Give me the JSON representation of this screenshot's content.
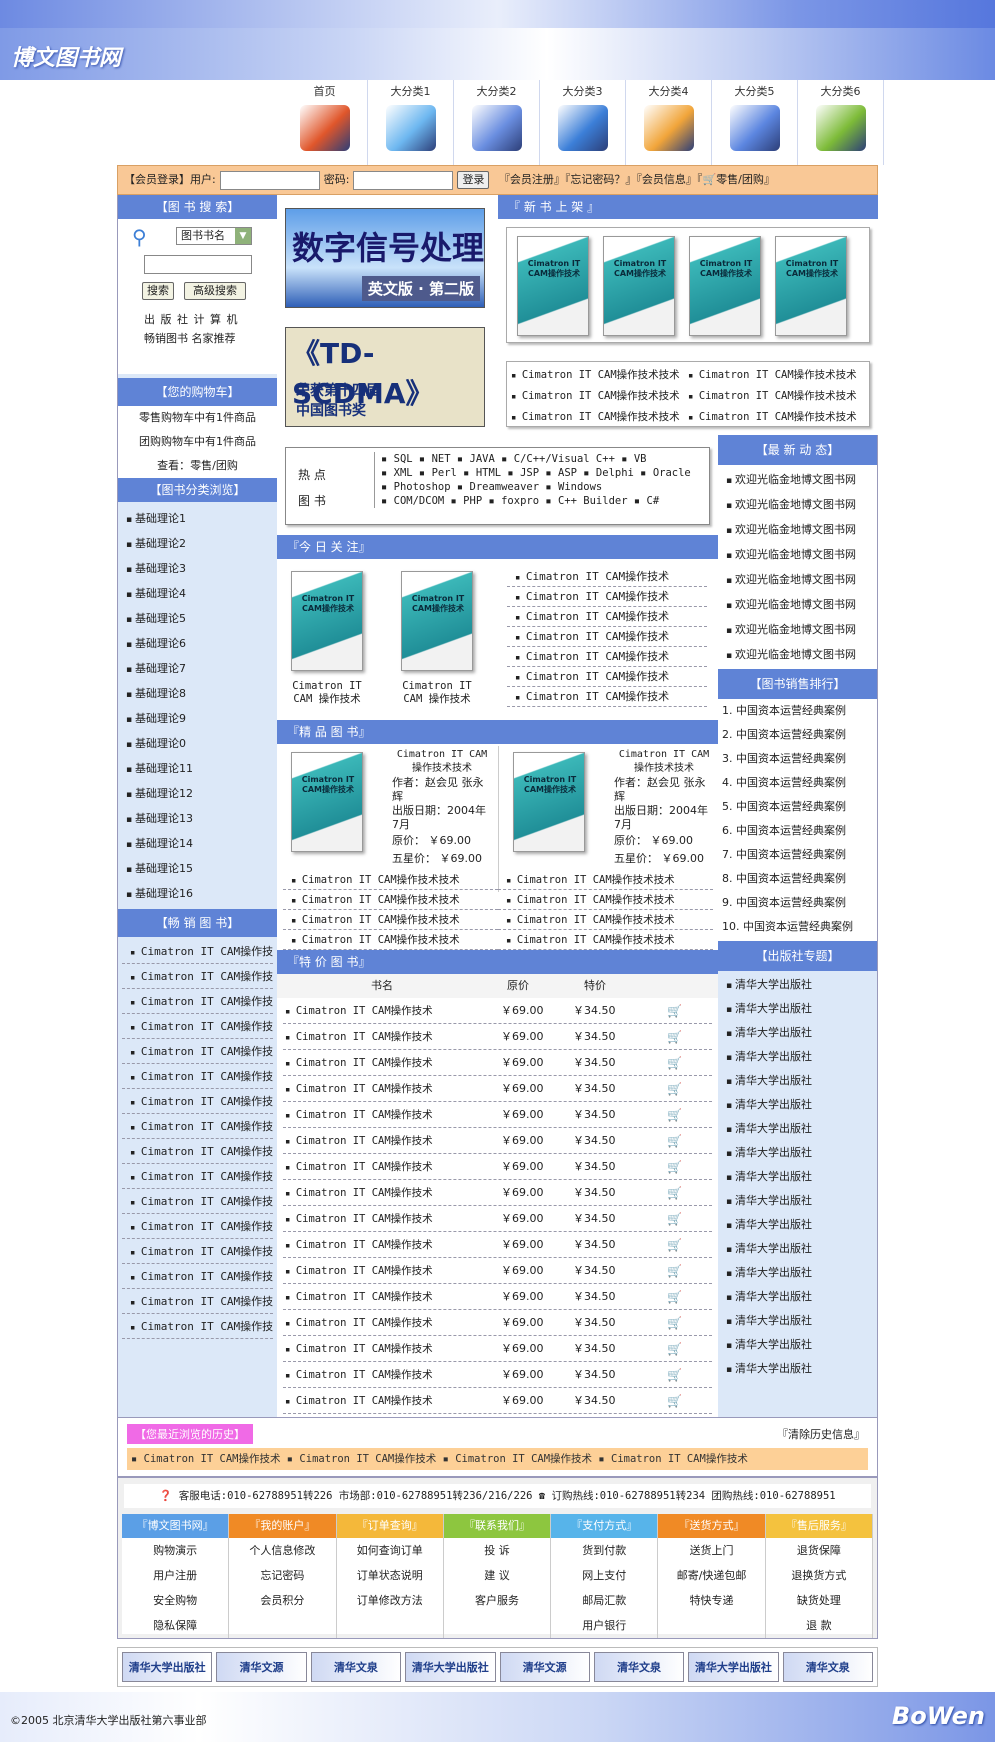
{
  "site": {
    "logo": "博文图书网",
    "brand": "BoWen",
    "copyright": "©2005 北京清华大学出版社第六事业部"
  },
  "nav": {
    "items": [
      "首页",
      "大分类1",
      "大分类2",
      "大分类3",
      "大分类4",
      "大分类5",
      "大分类6"
    ]
  },
  "login": {
    "prefix": "【会员登录】用户:",
    "pwd_label": "密码:",
    "submit": "登录",
    "links": "『会员注册』『忘记密码？』『会员信息』『",
    "cart_link": "零售/团购』"
  },
  "search": {
    "title": "【图 书 搜 索】",
    "select": "图书书名",
    "btn_search": "搜索",
    "btn_adv": "高级搜索",
    "links1": "出 版 社  计 算 机",
    "links2": "畅销图书  名家推荐"
  },
  "cart": {
    "title": "【您的购物车】",
    "line1": "零售购物车中有1件商品",
    "line2": "团购购物车中有1件商品",
    "line3": "查看：零售/团购"
  },
  "categories": {
    "title": "【图书分类浏览】",
    "items": [
      "基础理论1",
      "基础理论2",
      "基础理论3",
      "基础理论4",
      "基础理论5",
      "基础理论6",
      "基础理论7",
      "基础理论8",
      "基础理论9",
      "基础理论0",
      "基础理论11",
      "基础理论12",
      "基础理论13",
      "基础理论14",
      "基础理论15",
      "基础理论16"
    ]
  },
  "bestsell": {
    "title": "【畅 销 图 书】",
    "item": "Cimatron IT CAM操作技术",
    "count": 16
  },
  "banners": {
    "b1_title": "数字信号处理",
    "b1_sub": "英文版 · 第二版",
    "b2_title": "《TD-SCDMA》",
    "b2_sub1": "荣获第十四届",
    "b2_sub2": "中国图书奖"
  },
  "newbooks": {
    "title": "『 新 书 上 架 』",
    "cover_text": "Cimatron IT CAM操作技术",
    "list": [
      "Cimatron IT CAM操作技术技术",
      "Cimatron IT CAM操作技术技术",
      "Cimatron IT CAM操作技术技术",
      "Cimatron IT CAM操作技术技术",
      "Cimatron IT CAM操作技术技术",
      "Cimatron IT CAM操作技术技术"
    ]
  },
  "hot": {
    "label1": "热  点",
    "label2": "图  书",
    "row1": "▪ SQL  ▪ NET  ▪ JAVA  ▪ C/C++/Visual C++  ▪ VB",
    "row2": "▪ XML  ▪ Perl  ▪ HTML  ▪ JSP  ▪ ASP  ▪ Delphi  ▪ Oracle",
    "row3": "▪ Photoshop  ▪ Dreamweaver  ▪ Windows",
    "row4": "▪ COM/DCOM  ▪ PHP  ▪ foxpro  ▪ C++ Builder  ▪ C#"
  },
  "today": {
    "title": "『今 日 关 注』",
    "caption": "Cimatron IT CAM 操作技术",
    "item": "Cimatron IT CAM操作技术",
    "count": 7
  },
  "fine": {
    "title": "『精 品 图 书』",
    "name": "Cimatron IT CAM 操作技术技术",
    "author": "作者：赵会见 张永辉",
    "date": "出版日期：2004年7月",
    "price": "原价：  ￥69.00",
    "star": "五星价：  ￥69.00",
    "item": "Cimatron IT CAM操作技术技术"
  },
  "special": {
    "title": "『特 价 图 书』",
    "h_name": "书名",
    "h_orig": "原价",
    "h_spec": "特价",
    "name": "Cimatron IT CAM操作技术",
    "orig": "￥69.00",
    "spec": "￥34.50",
    "count": 16
  },
  "news": {
    "title": "【最 新 动 态】",
    "item": "欢迎光临金地博文图书网",
    "count": 8
  },
  "rank": {
    "title": "【图书销售排行】",
    "items": [
      "1. 中国资本运营经典案例",
      "2. 中国资本运营经典案例",
      "3. 中国资本运营经典案例",
      "4. 中国资本运营经典案例",
      "5. 中国资本运营经典案例",
      "6. 中国资本运营经典案例",
      "7. 中国资本运营经典案例",
      "8. 中国资本运营经典案例",
      "9. 中国资本运营经典案例",
      "10. 中国资本运营经典案例"
    ]
  },
  "publisher": {
    "title": "【出版社专题】",
    "item": "清华大学出版社",
    "count": 17
  },
  "history": {
    "title": "【您最近浏览的历史】",
    "clear": "『清除历史信息』",
    "text": "▪ Cimatron IT CAM操作技术  ▪ Cimatron IT CAM操作技术  ▪ Cimatron IT CAM操作技术  ▪ Cimatron IT CAM操作技术"
  },
  "footer": {
    "contact": "客服电话:010-62788951转226  市场部:010-62788951转236/216/226",
    "contact2": "订购热线:010-62788951转234  团购热线:010-62788951",
    "cols": [
      {
        "title": "『博文图书网』",
        "color": "#5b9fe6",
        "items": [
          "购物演示",
          "用户注册",
          "安全购物",
          "隐私保障"
        ]
      },
      {
        "title": "『我的账户』",
        "color": "#f08a25",
        "items": [
          "个人信息修改",
          "忘记密码",
          "会员积分"
        ]
      },
      {
        "title": "『订单查询』",
        "color": "#f4b83a",
        "items": [
          "如何查询订单",
          "订单状态说明",
          "订单修改方法"
        ]
      },
      {
        "title": "『联系我们』",
        "color": "#8dc63f",
        "items": [
          "投    诉",
          "建    议",
          "客户服务"
        ]
      },
      {
        "title": "『支付方式』",
        "color": "#57b4ea",
        "items": [
          "货到付款",
          "网上支付",
          "邮局汇款",
          "用户银行"
        ]
      },
      {
        "title": "『送货方式』",
        "color": "#f08a25",
        "items": [
          "送货上门",
          "邮寄/快递包邮",
          "特快专递"
        ]
      },
      {
        "title": "『售后服务』",
        "color": "#f4c23e",
        "items": [
          "退货保障",
          "退换货方式",
          "缺货处理",
          "退    款"
        ]
      }
    ],
    "logos": [
      "清华大学出版社",
      "清华文源",
      "清华文泉",
      "清华大学出版社",
      "清华文源",
      "清华文泉",
      "清华大学出版社",
      "清华文泉"
    ]
  }
}
